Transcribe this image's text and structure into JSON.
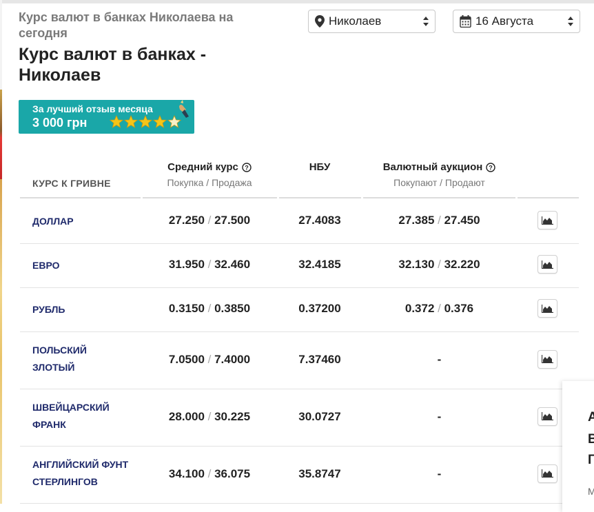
{
  "header": {
    "subtitle": "Курс валют в банках Николаева на сегодня",
    "title": "Курс валют в банках - Николаев",
    "city_select": {
      "value": "Николаев",
      "icon": "map-pin-icon"
    },
    "date_select": {
      "value": "16 Августа",
      "icon": "calendar-icon"
    }
  },
  "promo": {
    "line1": "За лучший отзыв месяца",
    "line2": "3 000 грн",
    "stars": 5
  },
  "table": {
    "headers": {
      "currency": "КУРС К ГРИВНЕ",
      "average": {
        "title": "Средний курс",
        "sub": "Покупка / Продажа"
      },
      "nbu": {
        "title": "НБУ"
      },
      "auction": {
        "title": "Валютный аукцион",
        "sub": "Покупают / Продают"
      }
    },
    "rows": [
      {
        "currency": "ДОЛЛАР",
        "avg_buy": "27.250",
        "avg_sell": "27.500",
        "nbu": "27.4083",
        "auc_buy": "27.385",
        "auc_sell": "27.450",
        "auc": ""
      },
      {
        "currency": "ЕВРО",
        "avg_buy": "31.950",
        "avg_sell": "32.460",
        "nbu": "32.4185",
        "auc_buy": "32.130",
        "auc_sell": "32.220",
        "auc": ""
      },
      {
        "currency": "РУБЛЬ",
        "avg_buy": "0.3150",
        "avg_sell": "0.3850",
        "nbu": "0.37200",
        "auc_buy": "0.372",
        "auc_sell": "0.376",
        "auc": ""
      },
      {
        "currency": "ПОЛЬСКИЙ ЗЛОТЫЙ",
        "avg_buy": "7.0500",
        "avg_sell": "7.4000",
        "nbu": "7.37460",
        "auc_buy": "",
        "auc_sell": "",
        "auc": "-"
      },
      {
        "currency": "ШВЕЙЦАРСКИЙ ФРАНК",
        "avg_buy": "28.000",
        "avg_sell": "30.225",
        "nbu": "30.0727",
        "auc_buy": "",
        "auc_sell": "",
        "auc": "-"
      },
      {
        "currency": "АНГЛИЙСКИЙ ФУНТ СТЕРЛИНГОВ",
        "avg_buy": "34.100",
        "avg_sell": "36.075",
        "nbu": "35.8747",
        "auc_buy": "",
        "auc_sell": "",
        "auc": "-"
      }
    ],
    "chart_button_icon": "area-chart-icon"
  },
  "side_card": {
    "letters": [
      "А",
      "В",
      "Г"
    ],
    "sub": "М"
  },
  "colors": {
    "promo_bg": "#1aa7a8",
    "currency_text": "#1f2a6b",
    "star": "#f5c518"
  }
}
